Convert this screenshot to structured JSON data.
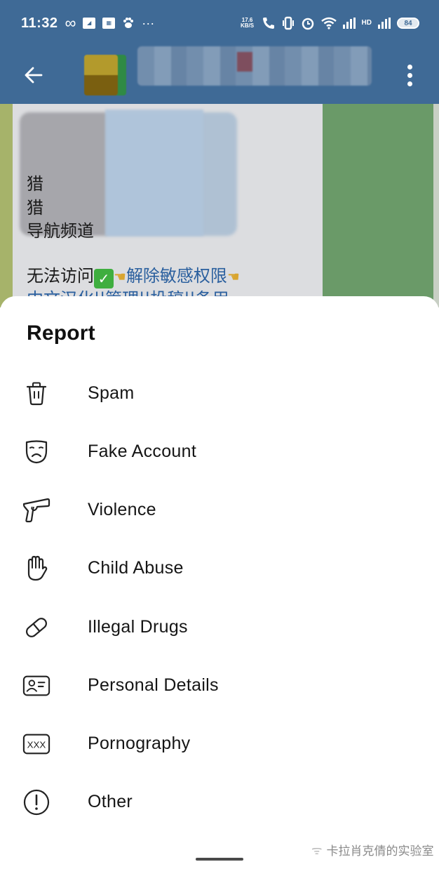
{
  "status_bar": {
    "time": "11:32",
    "net_speed_value": "17.6",
    "net_speed_unit": "KB/S",
    "battery": "84",
    "left_icons": [
      "infinity-icon",
      "gallery-icon",
      "app-icon",
      "paw-icon",
      "more-dots-icon"
    ],
    "right_icons": [
      "phone-icon",
      "vibrate-icon",
      "alarm-icon",
      "wifi-icon",
      "signal-icon",
      "hd-icon",
      "signal-icon",
      "battery-icon"
    ]
  },
  "app_bar": {
    "back_icon": "arrow-left-icon",
    "title": "",
    "menu_icon": "more-vertical-icon"
  },
  "chat": {
    "lines": [
      {
        "text": "猎"
      },
      {
        "text": "猎"
      },
      {
        "text": "导航频道"
      },
      {
        "text": "无法访问",
        "check": "✓",
        "link": "解除敏感权限"
      },
      {
        "text": "中文汉化||管理||投稿||备用"
      }
    ]
  },
  "sheet": {
    "title": "Report",
    "options": [
      {
        "label": "Spam",
        "icon": "trash-icon"
      },
      {
        "label": "Fake Account",
        "icon": "sad-mask-icon"
      },
      {
        "label": "Violence",
        "icon": "pistol-icon"
      },
      {
        "label": "Child Abuse",
        "icon": "hand-icon"
      },
      {
        "label": "Illegal Drugs",
        "icon": "pill-icon"
      },
      {
        "label": "Personal Details",
        "icon": "id-card-icon"
      },
      {
        "label": "Pornography",
        "icon": "xxx-icon"
      },
      {
        "label": "Other",
        "icon": "exclamation-circle-icon"
      }
    ]
  },
  "watermark": {
    "text": "卡拉肖克倩的实验室"
  },
  "colors": {
    "app_bar": "#3f6a96",
    "sheet_bg": "#ffffff",
    "chat_wallpaper": "#6a9a68",
    "link": "#2a5f9e"
  }
}
